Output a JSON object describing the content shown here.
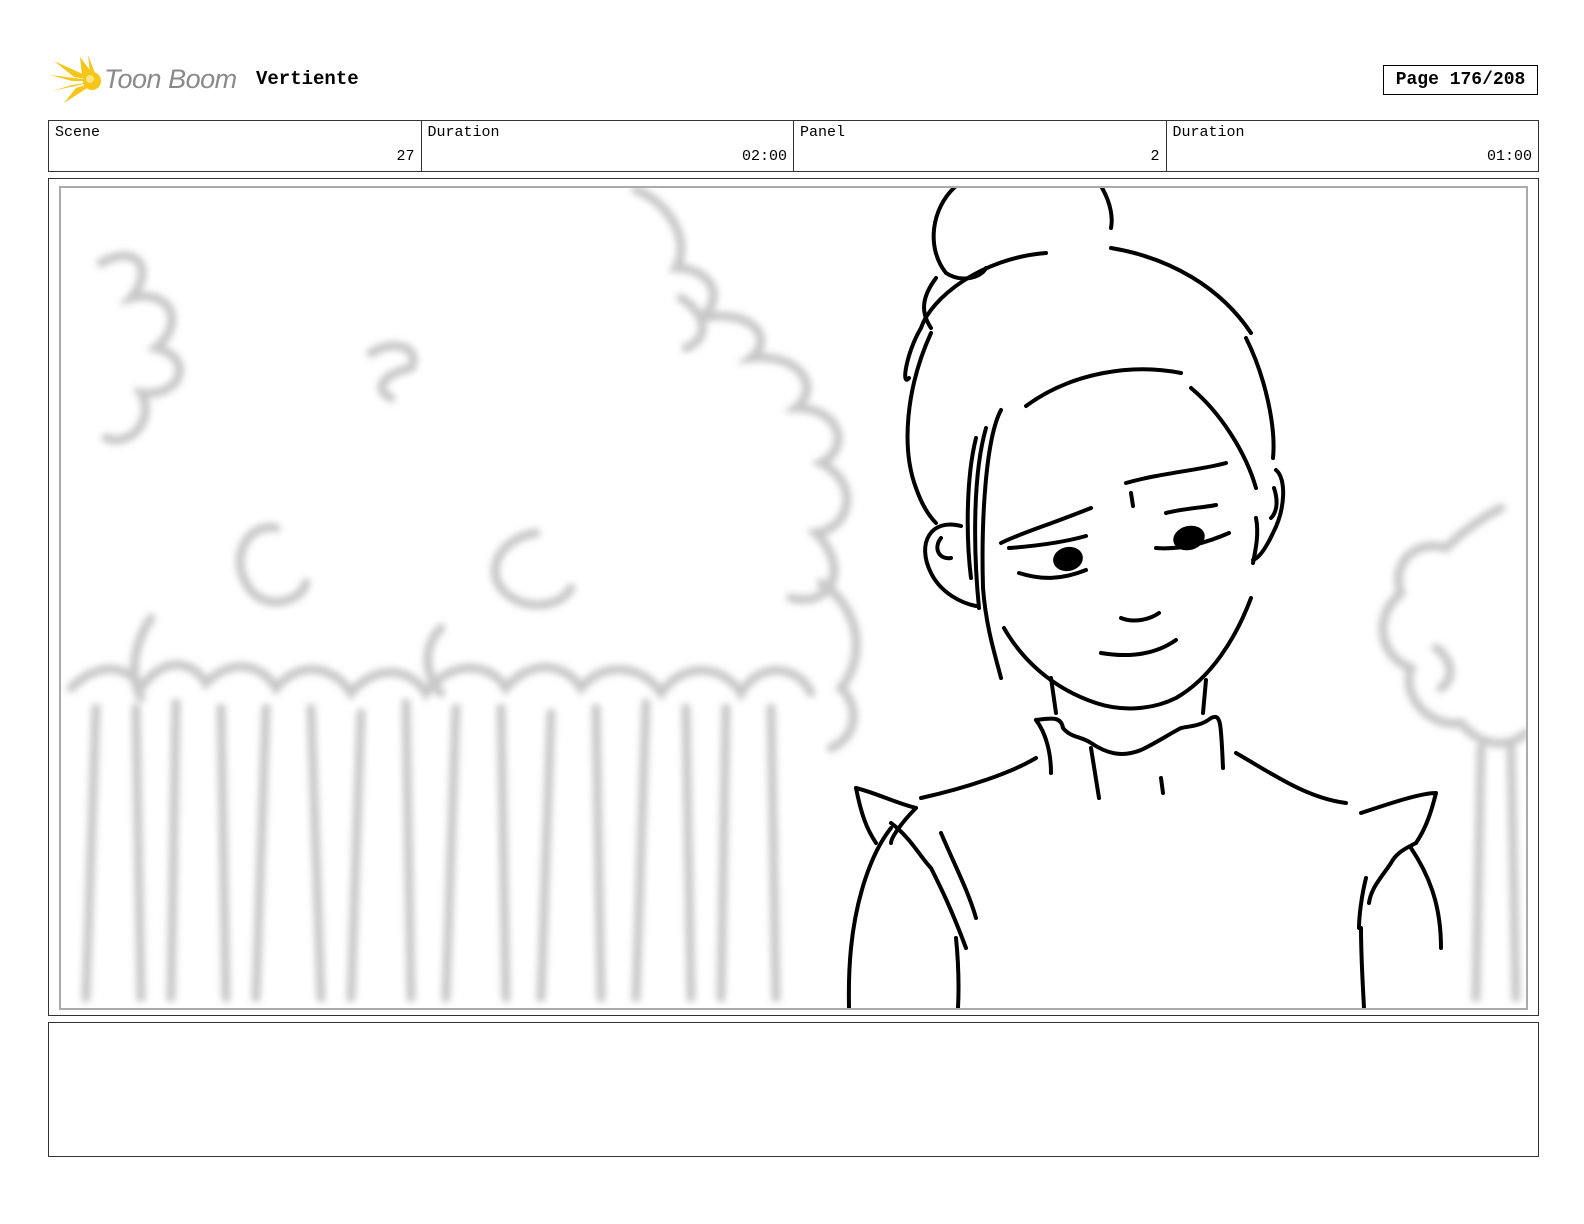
{
  "header": {
    "logo_text": "Toon Boom",
    "project_title": "Vertiente",
    "page_label": "Page 176/208"
  },
  "info": {
    "scene_label": "Scene",
    "scene_value": "27",
    "scene_duration_label": "Duration",
    "scene_duration_value": "02:00",
    "panel_label": "Panel",
    "panel_value": "2",
    "panel_duration_label": "Duration",
    "panel_duration_value": "01:00"
  },
  "notes": {
    "text": ""
  },
  "colors": {
    "logo_accent": "#f5c518",
    "logo_text": "#8a8a8a"
  },
  "icons": {
    "logo": "toon-boom-starburst-icon"
  }
}
